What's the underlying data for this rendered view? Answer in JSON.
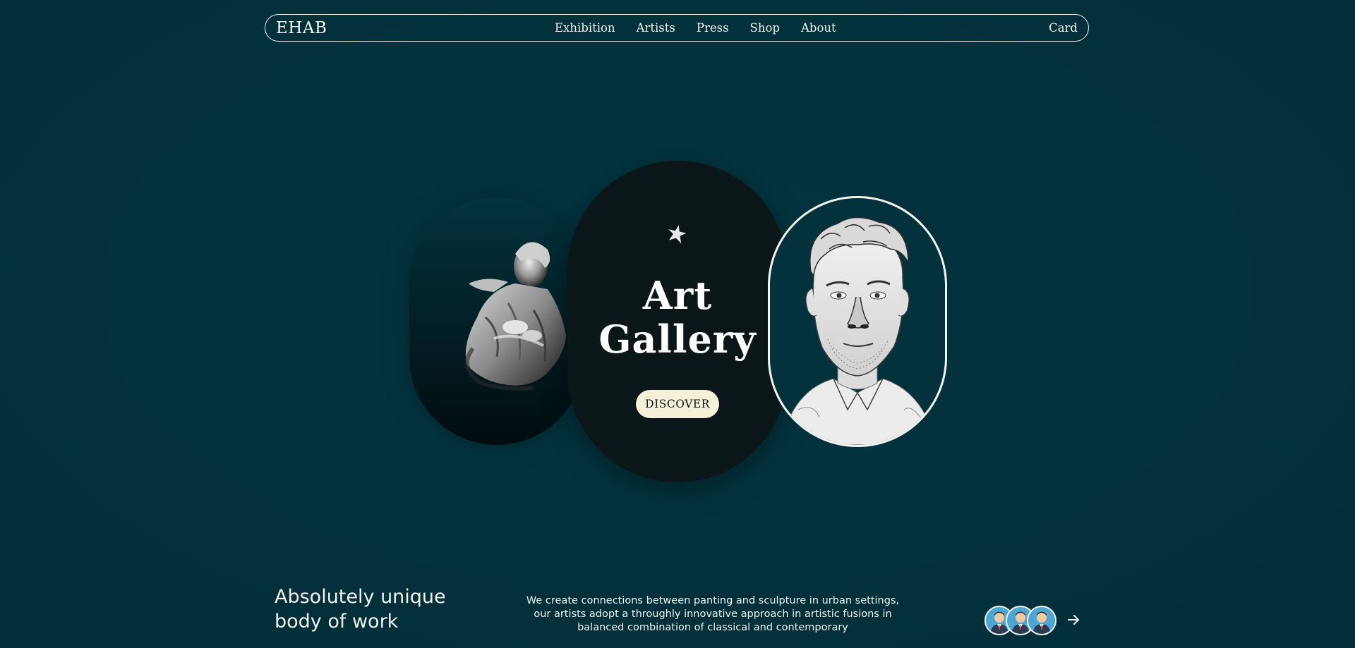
{
  "nav": {
    "logo": "EHAB",
    "links": [
      "Exhibition",
      "Artists",
      "Press",
      "Shop",
      "About"
    ],
    "cart": "Card"
  },
  "hero": {
    "title_line1": "Art",
    "title_line2": "Gallery",
    "cta": "DISCOVER",
    "icons": [
      "star-icon",
      "statue-image",
      "portrait-sketch-image"
    ]
  },
  "about": {
    "tagline_line1": "Absolutely unique",
    "tagline_line2": "body of work",
    "description": "We create connections between panting and sculpture in urban settings, our artists adopt a throughly innovative approach in artistic fusions in balanced combination of classical and contemporary"
  },
  "colors": {
    "background": "#03313c",
    "center_pill": "#0a1617",
    "button_bg": "#f5f0d8",
    "text": "#f2f2ec",
    "avatar_bg": "#4ea6d4"
  }
}
